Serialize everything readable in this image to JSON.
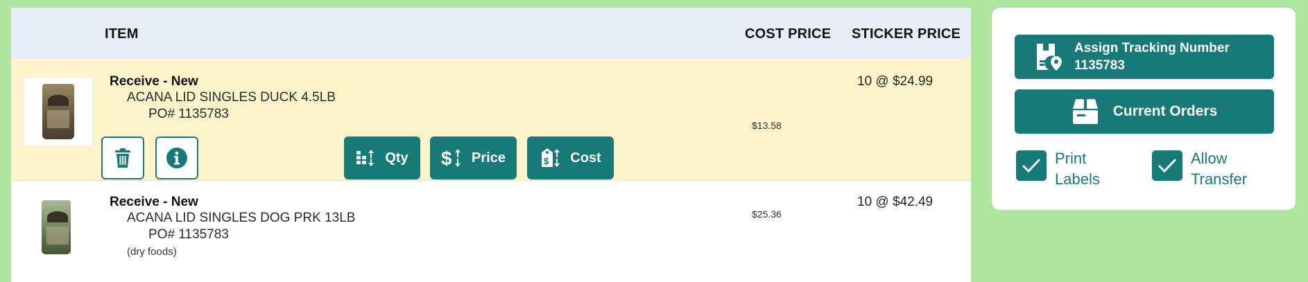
{
  "table": {
    "headers": {
      "item": "ITEM",
      "cost": "COST PRICE",
      "sticker": "STICKER PRICE"
    },
    "rows": [
      {
        "title": "Receive - New",
        "name": "ACANA LID SINGLES DUCK 4.5LB",
        "po": "PO# 1135783",
        "category": "",
        "cost": "$13.58",
        "sticker": "10 @ $24.99",
        "actions": {
          "qty": "Qty",
          "price": "Price",
          "cost": "Cost"
        }
      },
      {
        "title": "Receive - New",
        "name": "ACANA LID SINGLES DOG PRK 13LB",
        "po": "PO# 1135783",
        "category": "(dry foods)",
        "cost": "$25.36",
        "sticker": "10 @ $42.49"
      }
    ]
  },
  "side": {
    "assign_line1": "Assign Tracking Number",
    "assign_line2": "1135783",
    "current_orders": "Current Orders",
    "print_line1": "Print",
    "print_line2": "Labels",
    "transfer_line1": "Allow",
    "transfer_line2": "Transfer"
  },
  "colors": {
    "background": "#aee6a0",
    "accent": "#167a78",
    "selected_row": "#fdf5c9",
    "header": "#e8ecf6"
  }
}
